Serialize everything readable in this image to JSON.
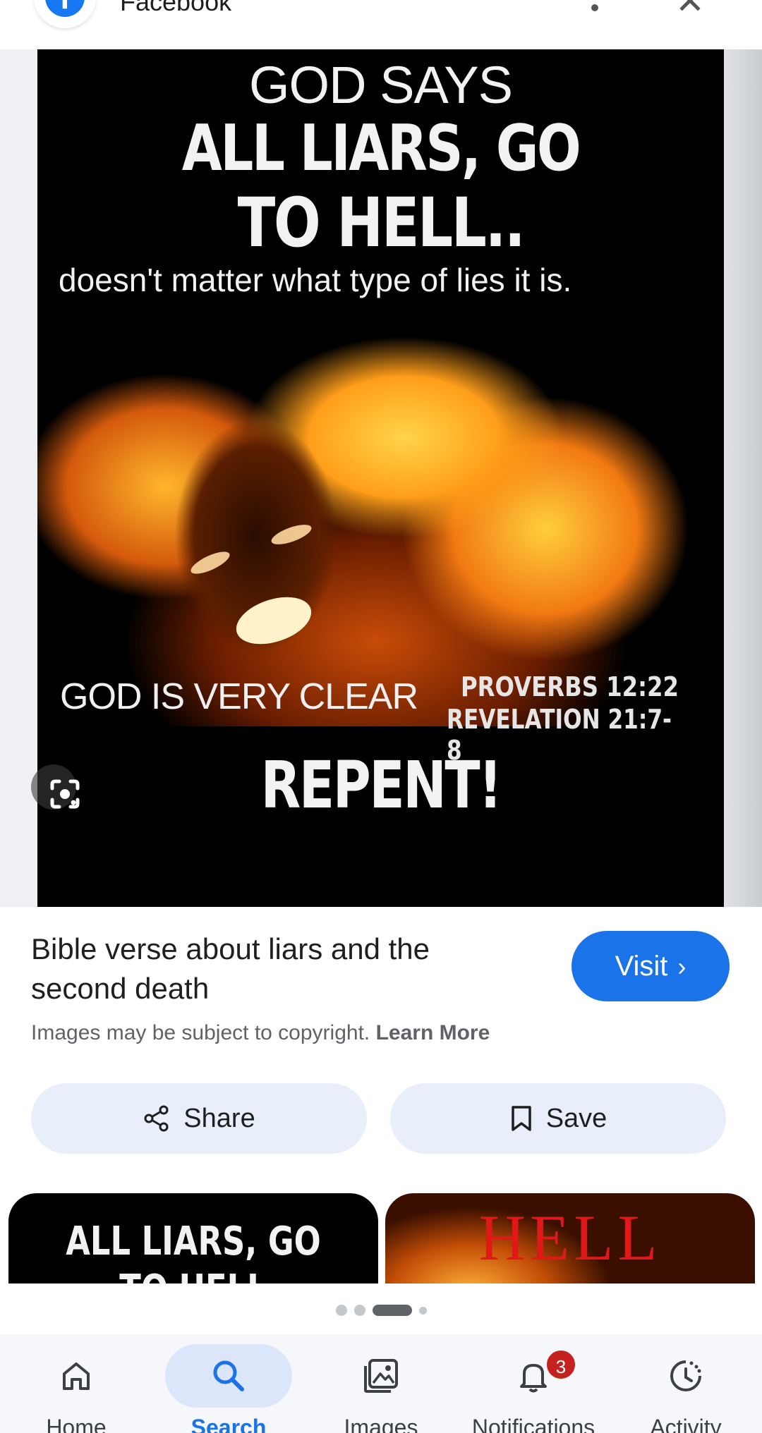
{
  "header": {
    "source_name": "Facebook",
    "logo_letter": "f"
  },
  "image": {
    "line1": "GOD SAYS",
    "line2": "ALL LIARS, GO",
    "line3": "TO HELL..",
    "line4": "doesn't matter what type of lies it is.",
    "line5": "GOD IS VERY CLEAR",
    "ref1": "PROVERBS 12:22",
    "ref2": "REVELATION 21:7-8",
    "line6": "REPENT!"
  },
  "result": {
    "title": "Bible verse about liars and the second death",
    "copyright_text": "Images may be subject to copyright.",
    "learn_more": "Learn More",
    "visit_label": "Visit",
    "visit_color": "#1a73e8"
  },
  "actions": {
    "share_label": "Share",
    "save_label": "Save"
  },
  "related": [
    {
      "line1": "ALL LIARS, GO",
      "line2": "TO HELL"
    },
    {
      "text": "HELL"
    }
  ],
  "pager": {
    "count": 4,
    "active_index": 2
  },
  "bottom_nav": {
    "items": [
      {
        "label": "Home",
        "icon": "home-icon"
      },
      {
        "label": "Search",
        "icon": "search-icon"
      },
      {
        "label": "Images",
        "icon": "images-icon"
      },
      {
        "label": "Notifications",
        "icon": "bell-icon",
        "badge": "3"
      },
      {
        "label": "Activity",
        "icon": "activity-icon"
      }
    ],
    "active_index": 1
  }
}
